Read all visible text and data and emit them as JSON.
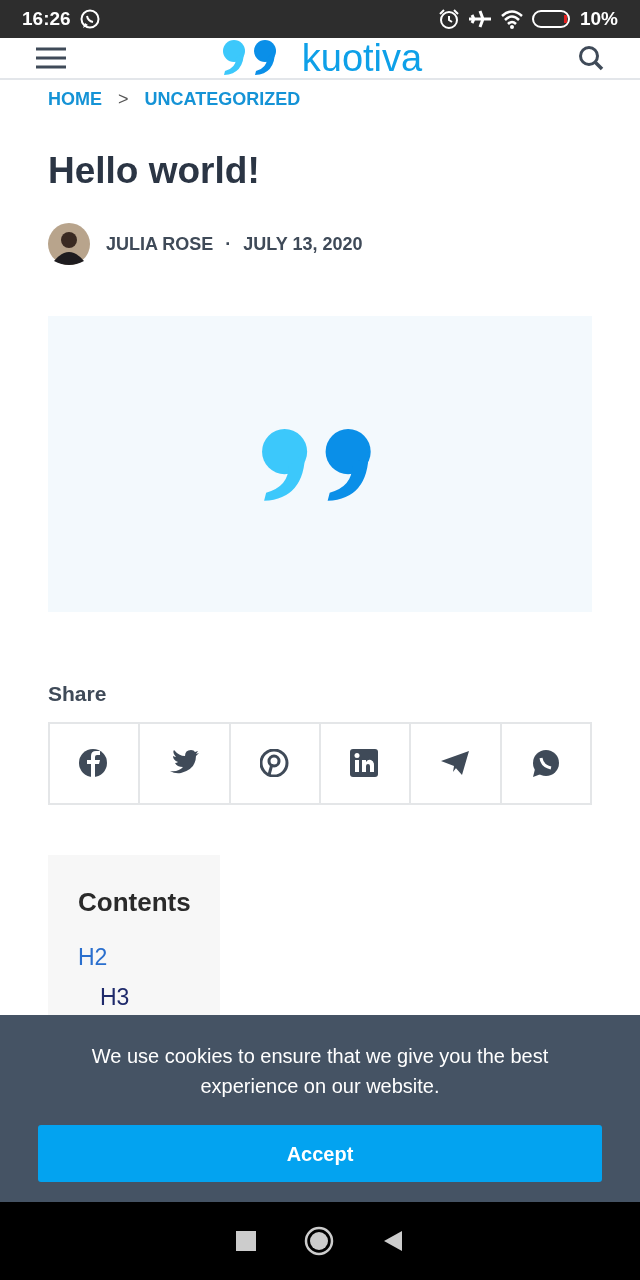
{
  "status_bar": {
    "time": "16:26",
    "battery": "10%"
  },
  "header": {
    "logo": "kuotiva"
  },
  "breadcrumb": [
    {
      "label": "HOME"
    },
    {
      "label": "UNCATEGORIZED"
    }
  ],
  "breadcrumb_separator": ">",
  "post": {
    "title": "Hello world!",
    "author": "JULIA ROSE",
    "separator": "·",
    "date": "JULY 13, 2020"
  },
  "share": {
    "title": "Share"
  },
  "contents": {
    "title": "Contents",
    "items": [
      {
        "label": "H2",
        "children": [
          {
            "label": "H3"
          }
        ]
      }
    ]
  },
  "cookie_banner": {
    "message": "We use cookies to ensure that we give you the best experience on our website.",
    "button": "Accept"
  }
}
